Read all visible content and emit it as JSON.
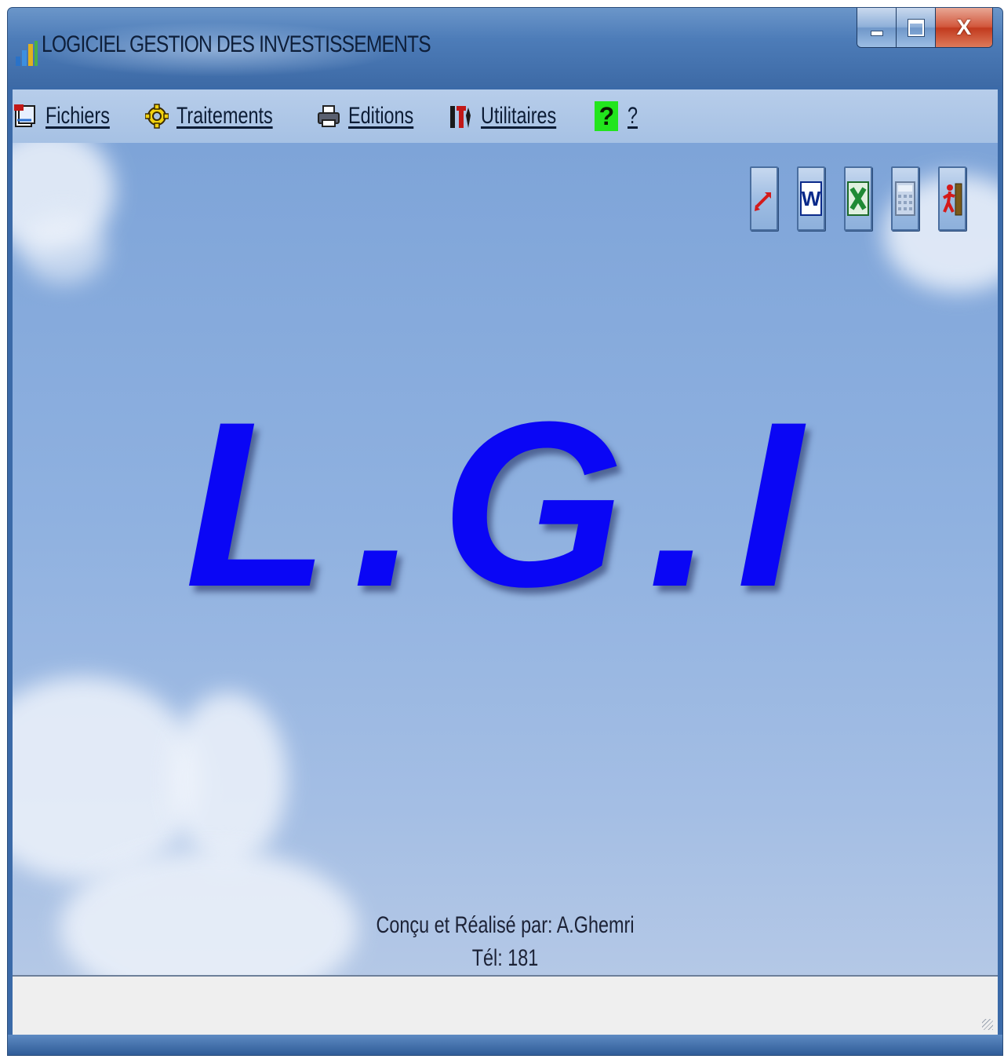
{
  "window": {
    "title": "LOGICIEL GESTION DES INVESTISSEMENTS",
    "app_icon": "app-icon",
    "controls": {
      "minimize": "minimize-icon",
      "maximize": "maximize-icon",
      "close_label": "X"
    }
  },
  "menu": {
    "items": [
      {
        "label": "Fichiers",
        "icon": "files-icon"
      },
      {
        "label": "Traitements",
        "icon": "gear-icon"
      },
      {
        "label": "Editions",
        "icon": "printer-icon"
      },
      {
        "label": "Utilitaires",
        "icon": "tools-icon"
      },
      {
        "label": "?",
        "icon": "help-icon",
        "icon_text": "?"
      }
    ]
  },
  "toolbar": {
    "buttons": [
      {
        "icon": "swap-arrows-icon"
      },
      {
        "icon": "word-icon"
      },
      {
        "icon": "excel-icon"
      },
      {
        "icon": "calculator-icon"
      },
      {
        "icon": "exit-icon"
      }
    ]
  },
  "main": {
    "logo_text": "L.G.I",
    "credit_line1": "Conçu et Réalisé par: A.Ghemri",
    "credit_line2": "Tél: 181"
  },
  "colors": {
    "logo": "#0a06f5",
    "help_badge": "#22e51d",
    "close_button": "#c23a1e"
  }
}
